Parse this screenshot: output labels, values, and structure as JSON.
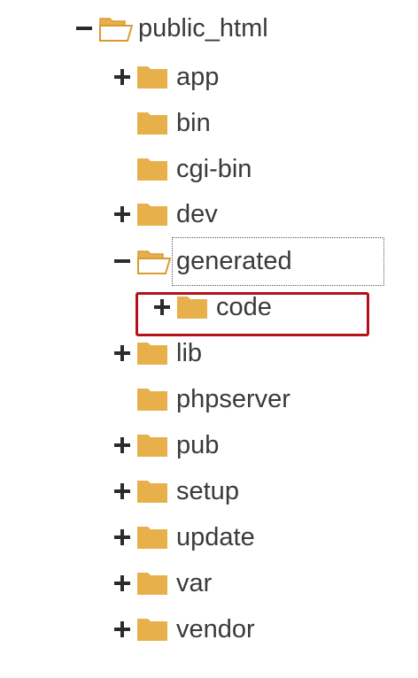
{
  "tree": {
    "root": {
      "label": "public_html",
      "state": "expanded"
    },
    "items": [
      {
        "label": "app",
        "toggle": "collapsed"
      },
      {
        "label": "bin",
        "toggle": "none"
      },
      {
        "label": "cgi-bin",
        "toggle": "none"
      },
      {
        "label": "dev",
        "toggle": "collapsed"
      },
      {
        "label": "generated",
        "toggle": "expanded",
        "selected": true
      },
      {
        "label": "code",
        "toggle": "collapsed",
        "highlighted": true
      },
      {
        "label": "lib",
        "toggle": "collapsed"
      },
      {
        "label": "phpserver",
        "toggle": "none"
      },
      {
        "label": "pub",
        "toggle": "collapsed"
      },
      {
        "label": "setup",
        "toggle": "collapsed"
      },
      {
        "label": "update",
        "toggle": "collapsed"
      },
      {
        "label": "var",
        "toggle": "collapsed"
      },
      {
        "label": "vendor",
        "toggle": "collapsed"
      }
    ]
  },
  "colors": {
    "folder": "#e8b04b",
    "folder_dark": "#d99a30",
    "highlight": "#b3121b",
    "text": "#3a3a3a"
  },
  "icons": {
    "expanded": "minus-icon",
    "collapsed": "plus-icon",
    "folder_closed": "folder-icon",
    "folder_open": "folder-open-icon"
  }
}
